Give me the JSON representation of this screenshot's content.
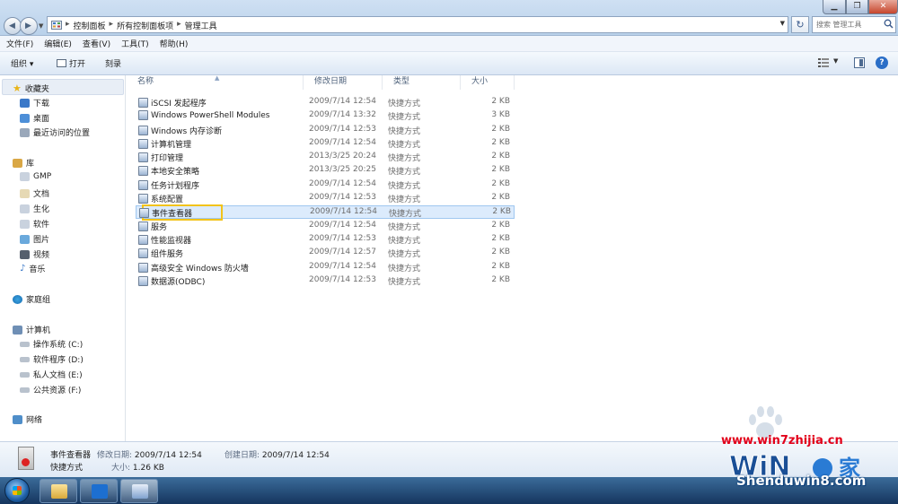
{
  "address_bar": {
    "breadcrumbs": [
      "控制面板",
      "所有控制面板项",
      "管理工具"
    ],
    "search_placeholder": "搜索 管理工具"
  },
  "menu": {
    "file": "文件(F)",
    "edit": "编辑(E)",
    "view": "查看(V)",
    "tools": "工具(T)",
    "help": "帮助(H)"
  },
  "toolbar": {
    "organize": "组织 ▾",
    "open": "打开",
    "burn": "刻录"
  },
  "nav": {
    "favorites": "收藏夹",
    "downloads": "下载",
    "desktop": "桌面",
    "recent": "最近访问的位置",
    "libraries": "库",
    "gmp": "GMP",
    "documents": "文档",
    "shenghua": "生化",
    "software": "软件",
    "pictures": "图片",
    "videos": "视频",
    "music": "音乐",
    "homegroup": "家庭组",
    "computer": "计算机",
    "drive_c": "操作系统 (C:)",
    "drive_d": "软件程序 (D:)",
    "drive_e": "私人文档 (E:)",
    "drive_f": "公共资源 (F:)",
    "network": "网络"
  },
  "columns": {
    "name": "名称",
    "date": "修改日期",
    "type": "类型",
    "size": "大小"
  },
  "files": [
    {
      "name": "iSCSI 发起程序",
      "date": "2009/7/14 12:54",
      "type": "快捷方式",
      "size": "2 KB"
    },
    {
      "name": "Windows PowerShell Modules",
      "date": "2009/7/14 13:32",
      "type": "快捷方式",
      "size": "3 KB"
    },
    {
      "name": "Windows 内存诊断",
      "date": "2009/7/14 12:53",
      "type": "快捷方式",
      "size": "2 KB"
    },
    {
      "name": "计算机管理",
      "date": "2009/7/14 12:54",
      "type": "快捷方式",
      "size": "2 KB"
    },
    {
      "name": "打印管理",
      "date": "2013/3/25 20:24",
      "type": "快捷方式",
      "size": "2 KB"
    },
    {
      "name": "本地安全策略",
      "date": "2013/3/25 20:25",
      "type": "快捷方式",
      "size": "2 KB"
    },
    {
      "name": "任务计划程序",
      "date": "2009/7/14 12:54",
      "type": "快捷方式",
      "size": "2 KB"
    },
    {
      "name": "系统配置",
      "date": "2009/7/14 12:53",
      "type": "快捷方式",
      "size": "2 KB"
    },
    {
      "name": "事件查看器",
      "date": "2009/7/14 12:54",
      "type": "快捷方式",
      "size": "2 KB"
    },
    {
      "name": "服务",
      "date": "2009/7/14 12:54",
      "type": "快捷方式",
      "size": "2 KB"
    },
    {
      "name": "性能监视器",
      "date": "2009/7/14 12:53",
      "type": "快捷方式",
      "size": "2 KB"
    },
    {
      "name": "组件服务",
      "date": "2009/7/14 12:57",
      "type": "快捷方式",
      "size": "2 KB"
    },
    {
      "name": "高级安全 Windows 防火墙",
      "date": "2009/7/14 12:54",
      "type": "快捷方式",
      "size": "2 KB"
    },
    {
      "name": "数据源(ODBC)",
      "date": "2009/7/14 12:53",
      "type": "快捷方式",
      "size": "2 KB"
    }
  ],
  "details": {
    "name": "事件查看器",
    "modified_label": "修改日期:",
    "modified_value": "2009/7/14 12:54",
    "created_label": "创建日期:",
    "created_value": "2009/7/14 12:54",
    "type": "快捷方式",
    "size_label": "大小:",
    "size_value": "1.26 KB"
  },
  "watermark": {
    "url1": "www.win7zhijia.cn",
    "url2": "Shenduwin8.com"
  },
  "colors": {
    "selection": "#dcebfc",
    "highlight_box": "#f2c31a",
    "watermark_red": "#e2001a",
    "watermark_white": "#ffffff"
  }
}
